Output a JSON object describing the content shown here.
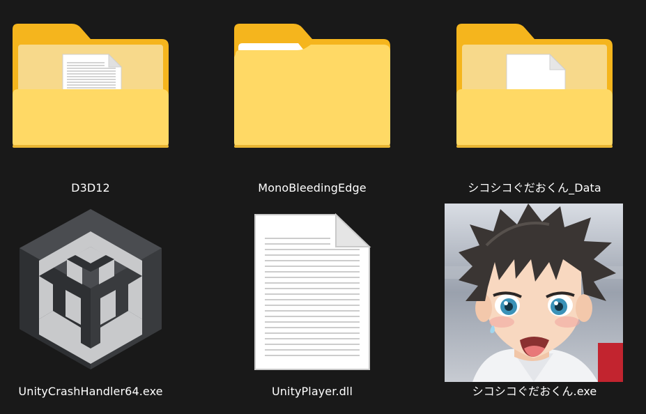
{
  "files": [
    {
      "name": "D3D12",
      "type": "folder-with-document",
      "icon": "folder-icon"
    },
    {
      "name": "MonoBleedingEdge",
      "type": "folder",
      "icon": "folder-icon"
    },
    {
      "name": "シコシコぐだおくん_Data",
      "type": "folder-with-blank-document",
      "icon": "folder-icon"
    },
    {
      "name": "UnityCrashHandler64.exe",
      "type": "executable",
      "icon": "unity-logo-icon"
    },
    {
      "name": "UnityPlayer.dll",
      "type": "library",
      "icon": "document-icon"
    },
    {
      "name": "シコシコぐだおくん.exe",
      "type": "executable",
      "icon": "anime-character-icon"
    }
  ],
  "colors": {
    "background": "#191919",
    "folder_back": "#f5b51d",
    "folder_front": "#ffd965",
    "text": "#ffffff"
  }
}
